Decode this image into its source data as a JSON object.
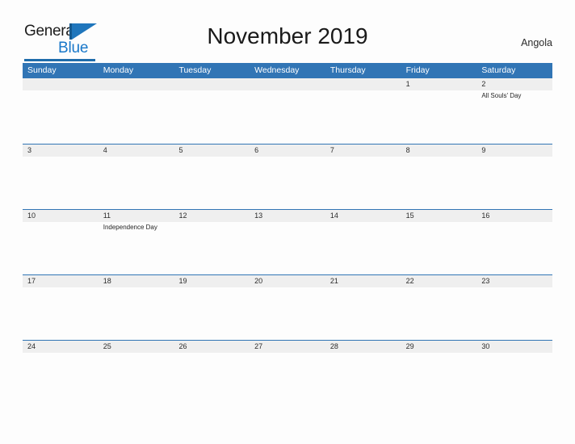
{
  "brand": {
    "word_one": "General",
    "word_two": "Blue",
    "logo_icon": "triangle-flag-icon",
    "accent_dark": "#14598f",
    "accent_mid": "#1f76bc",
    "accent_light": "#1877c9"
  },
  "header": {
    "title": "November 2019",
    "country": "Angola"
  },
  "calendar": {
    "header_color": "#3175b5",
    "band_color": "#efefef",
    "weekdays": [
      "Sunday",
      "Monday",
      "Tuesday",
      "Wednesday",
      "Thursday",
      "Friday",
      "Saturday"
    ],
    "weeks": [
      [
        {
          "day": ""
        },
        {
          "day": ""
        },
        {
          "day": ""
        },
        {
          "day": ""
        },
        {
          "day": ""
        },
        {
          "day": "1"
        },
        {
          "day": "2",
          "event": "All Souls' Day"
        }
      ],
      [
        {
          "day": "3"
        },
        {
          "day": "4"
        },
        {
          "day": "5"
        },
        {
          "day": "6"
        },
        {
          "day": "7"
        },
        {
          "day": "8"
        },
        {
          "day": "9"
        }
      ],
      [
        {
          "day": "10"
        },
        {
          "day": "11",
          "event": "Independence Day"
        },
        {
          "day": "12"
        },
        {
          "day": "13"
        },
        {
          "day": "14"
        },
        {
          "day": "15"
        },
        {
          "day": "16"
        }
      ],
      [
        {
          "day": "17"
        },
        {
          "day": "18"
        },
        {
          "day": "19"
        },
        {
          "day": "20"
        },
        {
          "day": "21"
        },
        {
          "day": "22"
        },
        {
          "day": "23"
        }
      ],
      [
        {
          "day": "24"
        },
        {
          "day": "25"
        },
        {
          "day": "26"
        },
        {
          "day": "27"
        },
        {
          "day": "28"
        },
        {
          "day": "29"
        },
        {
          "day": "30"
        }
      ]
    ]
  }
}
